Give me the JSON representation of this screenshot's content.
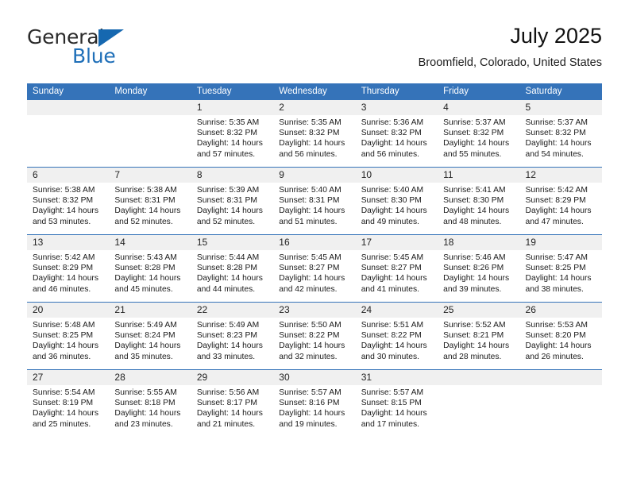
{
  "logo": {
    "word1": "General",
    "word2": "Blue",
    "triangle_color": "#1668b0",
    "blue_color": "#1f6fb8"
  },
  "header": {
    "title": "July 2025",
    "subtitle": "Broomfield, Colorado, United States"
  },
  "theme": {
    "header_bg": "#3573b9",
    "daynum_bg": "#f0f0f0",
    "row_divider": "#3573b9"
  },
  "weekday_headers": [
    "Sunday",
    "Monday",
    "Tuesday",
    "Wednesday",
    "Thursday",
    "Friday",
    "Saturday"
  ],
  "labels": {
    "sunrise_prefix": "Sunrise:",
    "sunset_prefix": "Sunset:",
    "daylight_prefix": "Daylight:"
  },
  "weeks": [
    [
      {
        "day": "",
        "blank": true
      },
      {
        "day": "",
        "blank": true
      },
      {
        "day": "1",
        "sunrise": "Sunrise: 5:35 AM",
        "sunset": "Sunset: 8:32 PM",
        "daylight1": "Daylight: 14 hours",
        "daylight2": "and 57 minutes."
      },
      {
        "day": "2",
        "sunrise": "Sunrise: 5:35 AM",
        "sunset": "Sunset: 8:32 PM",
        "daylight1": "Daylight: 14 hours",
        "daylight2": "and 56 minutes."
      },
      {
        "day": "3",
        "sunrise": "Sunrise: 5:36 AM",
        "sunset": "Sunset: 8:32 PM",
        "daylight1": "Daylight: 14 hours",
        "daylight2": "and 56 minutes."
      },
      {
        "day": "4",
        "sunrise": "Sunrise: 5:37 AM",
        "sunset": "Sunset: 8:32 PM",
        "daylight1": "Daylight: 14 hours",
        "daylight2": "and 55 minutes."
      },
      {
        "day": "5",
        "sunrise": "Sunrise: 5:37 AM",
        "sunset": "Sunset: 8:32 PM",
        "daylight1": "Daylight: 14 hours",
        "daylight2": "and 54 minutes."
      }
    ],
    [
      {
        "day": "6",
        "sunrise": "Sunrise: 5:38 AM",
        "sunset": "Sunset: 8:32 PM",
        "daylight1": "Daylight: 14 hours",
        "daylight2": "and 53 minutes."
      },
      {
        "day": "7",
        "sunrise": "Sunrise: 5:38 AM",
        "sunset": "Sunset: 8:31 PM",
        "daylight1": "Daylight: 14 hours",
        "daylight2": "and 52 minutes."
      },
      {
        "day": "8",
        "sunrise": "Sunrise: 5:39 AM",
        "sunset": "Sunset: 8:31 PM",
        "daylight1": "Daylight: 14 hours",
        "daylight2": "and 52 minutes."
      },
      {
        "day": "9",
        "sunrise": "Sunrise: 5:40 AM",
        "sunset": "Sunset: 8:31 PM",
        "daylight1": "Daylight: 14 hours",
        "daylight2": "and 51 minutes."
      },
      {
        "day": "10",
        "sunrise": "Sunrise: 5:40 AM",
        "sunset": "Sunset: 8:30 PM",
        "daylight1": "Daylight: 14 hours",
        "daylight2": "and 49 minutes."
      },
      {
        "day": "11",
        "sunrise": "Sunrise: 5:41 AM",
        "sunset": "Sunset: 8:30 PM",
        "daylight1": "Daylight: 14 hours",
        "daylight2": "and 48 minutes."
      },
      {
        "day": "12",
        "sunrise": "Sunrise: 5:42 AM",
        "sunset": "Sunset: 8:29 PM",
        "daylight1": "Daylight: 14 hours",
        "daylight2": "and 47 minutes."
      }
    ],
    [
      {
        "day": "13",
        "sunrise": "Sunrise: 5:42 AM",
        "sunset": "Sunset: 8:29 PM",
        "daylight1": "Daylight: 14 hours",
        "daylight2": "and 46 minutes."
      },
      {
        "day": "14",
        "sunrise": "Sunrise: 5:43 AM",
        "sunset": "Sunset: 8:28 PM",
        "daylight1": "Daylight: 14 hours",
        "daylight2": "and 45 minutes."
      },
      {
        "day": "15",
        "sunrise": "Sunrise: 5:44 AM",
        "sunset": "Sunset: 8:28 PM",
        "daylight1": "Daylight: 14 hours",
        "daylight2": "and 44 minutes."
      },
      {
        "day": "16",
        "sunrise": "Sunrise: 5:45 AM",
        "sunset": "Sunset: 8:27 PM",
        "daylight1": "Daylight: 14 hours",
        "daylight2": "and 42 minutes."
      },
      {
        "day": "17",
        "sunrise": "Sunrise: 5:45 AM",
        "sunset": "Sunset: 8:27 PM",
        "daylight1": "Daylight: 14 hours",
        "daylight2": "and 41 minutes."
      },
      {
        "day": "18",
        "sunrise": "Sunrise: 5:46 AM",
        "sunset": "Sunset: 8:26 PM",
        "daylight1": "Daylight: 14 hours",
        "daylight2": "and 39 minutes."
      },
      {
        "day": "19",
        "sunrise": "Sunrise: 5:47 AM",
        "sunset": "Sunset: 8:25 PM",
        "daylight1": "Daylight: 14 hours",
        "daylight2": "and 38 minutes."
      }
    ],
    [
      {
        "day": "20",
        "sunrise": "Sunrise: 5:48 AM",
        "sunset": "Sunset: 8:25 PM",
        "daylight1": "Daylight: 14 hours",
        "daylight2": "and 36 minutes."
      },
      {
        "day": "21",
        "sunrise": "Sunrise: 5:49 AM",
        "sunset": "Sunset: 8:24 PM",
        "daylight1": "Daylight: 14 hours",
        "daylight2": "and 35 minutes."
      },
      {
        "day": "22",
        "sunrise": "Sunrise: 5:49 AM",
        "sunset": "Sunset: 8:23 PM",
        "daylight1": "Daylight: 14 hours",
        "daylight2": "and 33 minutes."
      },
      {
        "day": "23",
        "sunrise": "Sunrise: 5:50 AM",
        "sunset": "Sunset: 8:22 PM",
        "daylight1": "Daylight: 14 hours",
        "daylight2": "and 32 minutes."
      },
      {
        "day": "24",
        "sunrise": "Sunrise: 5:51 AM",
        "sunset": "Sunset: 8:22 PM",
        "daylight1": "Daylight: 14 hours",
        "daylight2": "and 30 minutes."
      },
      {
        "day": "25",
        "sunrise": "Sunrise: 5:52 AM",
        "sunset": "Sunset: 8:21 PM",
        "daylight1": "Daylight: 14 hours",
        "daylight2": "and 28 minutes."
      },
      {
        "day": "26",
        "sunrise": "Sunrise: 5:53 AM",
        "sunset": "Sunset: 8:20 PM",
        "daylight1": "Daylight: 14 hours",
        "daylight2": "and 26 minutes."
      }
    ],
    [
      {
        "day": "27",
        "sunrise": "Sunrise: 5:54 AM",
        "sunset": "Sunset: 8:19 PM",
        "daylight1": "Daylight: 14 hours",
        "daylight2": "and 25 minutes."
      },
      {
        "day": "28",
        "sunrise": "Sunrise: 5:55 AM",
        "sunset": "Sunset: 8:18 PM",
        "daylight1": "Daylight: 14 hours",
        "daylight2": "and 23 minutes."
      },
      {
        "day": "29",
        "sunrise": "Sunrise: 5:56 AM",
        "sunset": "Sunset: 8:17 PM",
        "daylight1": "Daylight: 14 hours",
        "daylight2": "and 21 minutes."
      },
      {
        "day": "30",
        "sunrise": "Sunrise: 5:57 AM",
        "sunset": "Sunset: 8:16 PM",
        "daylight1": "Daylight: 14 hours",
        "daylight2": "and 19 minutes."
      },
      {
        "day": "31",
        "sunrise": "Sunrise: 5:57 AM",
        "sunset": "Sunset: 8:15 PM",
        "daylight1": "Daylight: 14 hours",
        "daylight2": "and 17 minutes."
      },
      {
        "day": "",
        "blank": true
      },
      {
        "day": "",
        "blank": true
      }
    ]
  ]
}
